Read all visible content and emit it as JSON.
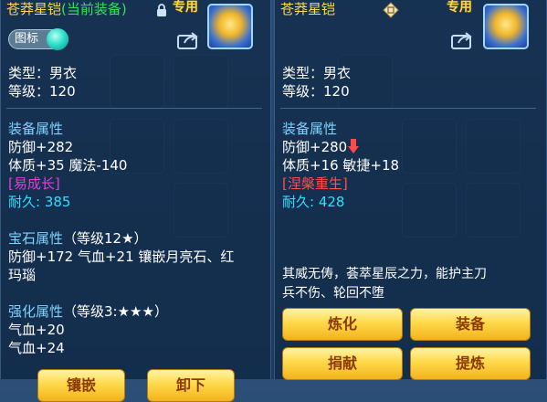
{
  "left": {
    "title": "苍莽星铠",
    "current_tag": "(当前装备)",
    "special": "专用",
    "toggle_label": "图标",
    "type_line": "类型：男衣",
    "level_line": "等级：120",
    "attr_header": "装备属性",
    "attr_lines": [
      "防御+282",
      "体质+35 魔法-140"
    ],
    "bonus": "[易成长]",
    "durability_label": "耐久:",
    "durability_value": "385",
    "gem_header": "宝石属性",
    "gem_level": "（等级12★）",
    "gem_line1": "防御+172 气血+21 镶嵌月亮石、红",
    "gem_line2": "玛瑙",
    "enhance_header": "强化属性",
    "enhance_level": "（等级3:★★★）",
    "enhance_lines": [
      "气血+20",
      "气血+24"
    ],
    "buttons": [
      "镶嵌",
      "卸下"
    ]
  },
  "right": {
    "title": "苍莽星铠",
    "special": "专用",
    "type_line": "类型：男衣",
    "level_line": "等级：120",
    "attr_header": "装备属性",
    "attr_line1": "防御+280",
    "attr_line2": "体质+16 敏捷+18",
    "bonus": "[涅槃重生]",
    "durability_label": "耐久:",
    "durability_value": "428",
    "description_line1": "其威无俦，荟萃星辰之力，能护主刀",
    "description_line2": "兵不伤、轮回不堕",
    "buttons": {
      "refine": "炼化",
      "equip": "装备",
      "donate": "捐献",
      "extract": "提炼"
    }
  },
  "colors": {
    "title": "#ffd84a",
    "current": "#2ee35a",
    "section": "#7fd3ff",
    "bonus_left": "#e43fd6",
    "bonus_right": "#ff4f4f",
    "durability": "#2de0ff"
  }
}
